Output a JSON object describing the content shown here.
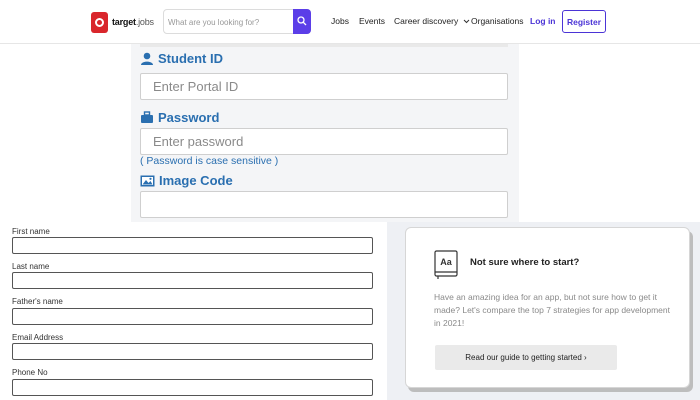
{
  "header": {
    "logo_primary": "target",
    "logo_secondary": "jobs",
    "search_placeholder": "What are you looking for?",
    "nav": {
      "jobs": "Jobs",
      "events": "Events",
      "career": "Career discovery",
      "organisations": "Organisations",
      "login": "Log in",
      "register": "Register"
    },
    "accent_color": "#5b3ee8"
  },
  "portal": {
    "student_id_label": "Student ID",
    "student_id_placeholder": "Enter Portal ID",
    "password_label": "Password",
    "password_placeholder": "Enter password",
    "password_note": "( Password is case sensitive )",
    "image_code_label": "Image Code",
    "label_color": "#2a6fb0"
  },
  "form": {
    "fields": [
      {
        "label": "First name"
      },
      {
        "label": "Last name"
      },
      {
        "label": "Father's name"
      },
      {
        "label": "Email Address"
      },
      {
        "label": "Phone No"
      }
    ]
  },
  "card": {
    "icon": "font-icon",
    "icon_text": "Aa",
    "title": "Not sure where to start?",
    "body": "Have an amazing idea for an app, but not sure how to get it made? Let's compare the top 7 strategies for app development in 2021!",
    "button": "Read our guide to getting started ›"
  }
}
